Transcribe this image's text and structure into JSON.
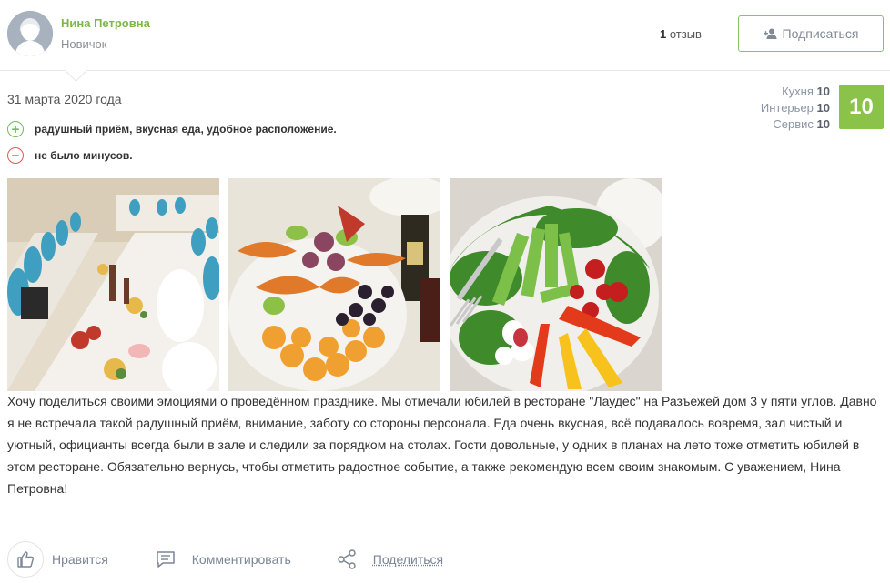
{
  "author": {
    "name": "Нина Петровна",
    "rank": "Новичок",
    "review_count": "1",
    "review_word": "отзыв",
    "subscribe_label": "Подписаться"
  },
  "review": {
    "date": "31 марта 2020 года",
    "pros": "радушный приём, вкусная еда, удобное расположение.",
    "cons": "не было минусов.",
    "text": "Хочу поделиться своими эмоциями о проведённом празднике. Мы отмечали юбилей в ресторане \"Лаудес\" на Разъежей дом 3 у пяти углов. Давно я не встречала такой радушный приём, внимание, заботу со стороны персонала. Еда очень вкусная, всё подавалось вовремя, зал чистый и уютный, официанты всегда были в зале и следили за порядком на столах. Гости довольные, у одних в планах на лето тоже отметить юбилей в этом ресторане. Обязательно вернусь, чтобы отметить радостное событие, а также рекомендую всем своим знакомым. С уважением, Нина Петровна!"
  },
  "ratings": {
    "kitchen_label": "Кухня",
    "kitchen_value": "10",
    "interior_label": "Интерьер",
    "interior_value": "10",
    "service_label": "Сервис",
    "service_value": "10",
    "total": "10"
  },
  "actions": {
    "like_label": "Нравится",
    "comment_label": "Комментировать",
    "share_label": "Поделиться"
  },
  "icons": {
    "avatar": "user-silhouette-icon",
    "subscribe": "add-user-icon",
    "pros": "plus-circle-icon",
    "cons": "minus-circle-icon",
    "like": "thumbs-up-icon",
    "comment": "comment-icon",
    "share": "share-icon"
  },
  "colors": {
    "accent_green": "#8bc34a",
    "author_name": "#7cb844",
    "pros_icon": "#6cbf55",
    "cons_icon": "#e05858",
    "muted_text": "#7a8595"
  }
}
